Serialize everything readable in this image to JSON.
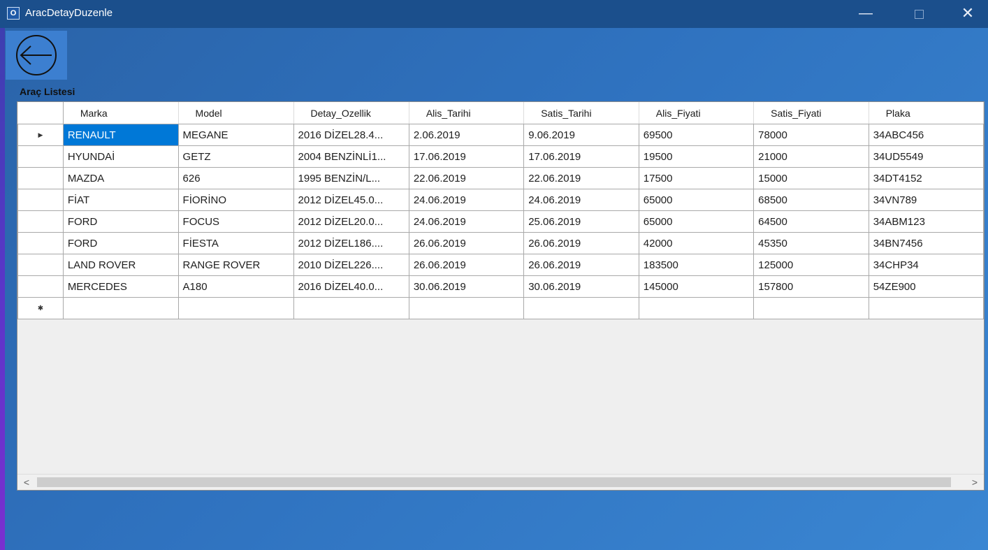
{
  "window": {
    "title": "AracDetayDuzenle",
    "icon_glyph": "O",
    "minimize_glyph": "—",
    "close_glyph": "✕"
  },
  "group_label": "Araç Listesi",
  "grid": {
    "columns": [
      "Marka",
      "Model",
      "Detay_Ozellik",
      "Alis_Tarihi",
      "Satis_Tarihi",
      "Alis_Fiyati",
      "Satis_Fiyati",
      "Plaka"
    ],
    "rows": [
      [
        "RENAULT",
        "MEGANE",
        "2016 DİZEL28.4...",
        "2.06.2019",
        "9.06.2019",
        "69500",
        "78000",
        "34ABC456"
      ],
      [
        "HYUNDAİ",
        "GETZ",
        "2004 BENZİNLİ1...",
        "17.06.2019",
        "17.06.2019",
        "19500",
        "21000",
        "34UD5549"
      ],
      [
        "MAZDA",
        "626",
        "1995 BENZİN/L...",
        "22.06.2019",
        "22.06.2019",
        "17500",
        "15000",
        "34DT4152"
      ],
      [
        "FİAT",
        "FİORİNO",
        "2012 DİZEL45.0...",
        "24.06.2019",
        "24.06.2019",
        "65000",
        "68500",
        "34VN789"
      ],
      [
        "FORD",
        "FOCUS",
        "2012 DİZEL20.0...",
        "24.06.2019",
        "25.06.2019",
        "65000",
        "64500",
        "34ABM123"
      ],
      [
        "FORD",
        "FİESTA",
        "2012 DİZEL186....",
        "26.06.2019",
        "26.06.2019",
        "42000",
        "45350",
        "34BN7456"
      ],
      [
        "LAND ROVER",
        "RANGE ROVER",
        "2010 DİZEL226....",
        "26.06.2019",
        "26.06.2019",
        "183500",
        "125000",
        "34CHP34"
      ],
      [
        "MERCEDES",
        "A180",
        "2016 DİZEL40.0...",
        "30.06.2019",
        "30.06.2019",
        "145000",
        "157800",
        "54ZE900"
      ]
    ],
    "current_row_glyph": "▶",
    "new_row_glyph": "✱",
    "scroll_left_glyph": "<",
    "scroll_right_glyph": ">"
  },
  "colors": {
    "selection": "#0078d7",
    "titlebar": "#1b4f8c"
  },
  "icons": {
    "back": "back-arrow-icon",
    "app": "app-icon"
  }
}
